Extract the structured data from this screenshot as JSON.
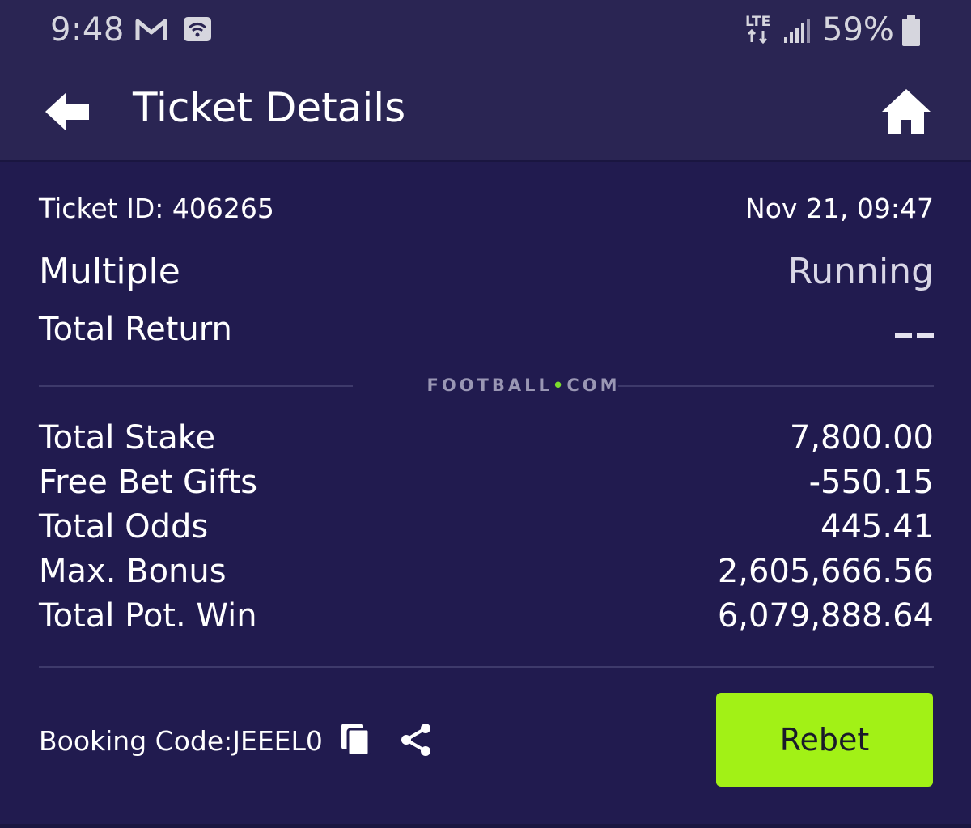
{
  "status_bar": {
    "time": "9:48",
    "network": "LTE",
    "battery": "59%",
    "icons": [
      "gmail-icon",
      "wifi-icon",
      "lte-icon",
      "signal-icon",
      "battery-icon"
    ]
  },
  "header": {
    "title": "Ticket Details",
    "back_icon": "arrow-left-icon",
    "home_icon": "home-icon"
  },
  "ticket": {
    "id_label": "Ticket ID: 406265",
    "datetime": "Nov 21, 09:47",
    "type": "Multiple",
    "status": "Running",
    "total_return_label": "Total Return",
    "total_return_value": "--"
  },
  "brand": {
    "name_part1": "FOOTBALL",
    "dot": "•",
    "name_part2": "COM"
  },
  "summary": [
    {
      "label": "Total Stake",
      "value": "7,800.00"
    },
    {
      "label": "Free Bet Gifts",
      "value": "-550.15"
    },
    {
      "label": "Total Odds",
      "value": "445.41"
    },
    {
      "label": "Max. Bonus",
      "value": "2,605,666.56"
    },
    {
      "label": "Total Pot. Win",
      "value": "6,079,888.64"
    }
  ],
  "footer": {
    "booking_code": "Booking Code:JEEEL0",
    "rebet_label": "Rebet"
  },
  "colors": {
    "background": "#211b4f",
    "header": "#2a2553",
    "accent_green": "#a2f116",
    "brand_dot": "#7bdc2c"
  }
}
